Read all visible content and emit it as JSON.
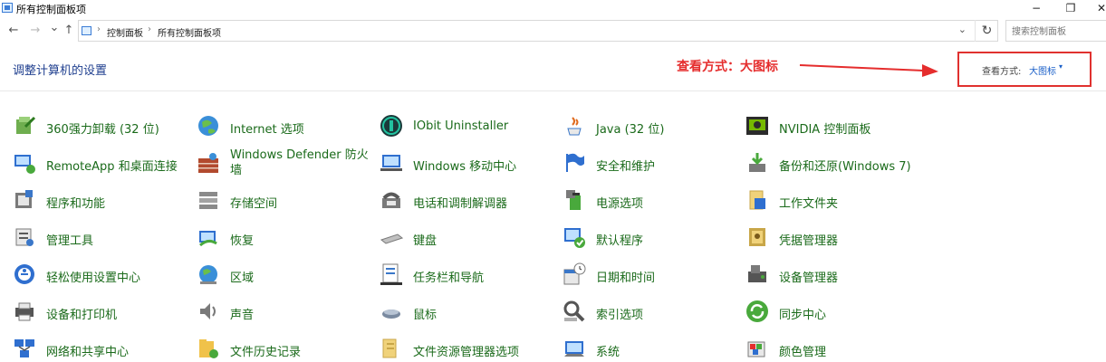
{
  "window": {
    "title": "所有控制面板项",
    "minimize": "−",
    "maximize": "❐",
    "close": "✕"
  },
  "nav": {
    "back": "←",
    "forward": "→",
    "recent": "⌄",
    "up": "↑",
    "breadcrumb": [
      "控制面板",
      "所有控制面板项"
    ],
    "dropdown": "⌄",
    "refresh": "↻",
    "search_placeholder": "搜索控制面板"
  },
  "page": {
    "heading": "调整计算机的设置",
    "annotation": "查看方式：大图标",
    "view_label": "查看方式:",
    "view_value": "大图标",
    "view_caret": "▾"
  },
  "colors": {
    "link_green": "#1a6a1a",
    "heading_blue": "#1f3f8f",
    "annotation_red": "#e52d2d",
    "view_link_blue": "#1a5fc8"
  },
  "items": [
    [
      {
        "label": "360强力卸载 (32 位)",
        "icon": "uninstall-icon"
      },
      {
        "label": "RemoteApp 和桌面连接",
        "icon": "remote-desktop-icon"
      },
      {
        "label": "程序和功能",
        "icon": "programs-icon"
      },
      {
        "label": "管理工具",
        "icon": "admin-tools-icon"
      },
      {
        "label": "轻松使用设置中心",
        "icon": "ease-of-access-icon"
      },
      {
        "label": "设备和打印机",
        "icon": "printer-icon"
      },
      {
        "label": "网络和共享中心",
        "icon": "network-icon"
      }
    ],
    [
      {
        "label": "Internet 选项",
        "icon": "globe-icon"
      },
      {
        "label": "Windows Defender 防火墙",
        "icon": "firewall-icon"
      },
      {
        "label": "存储空间",
        "icon": "storage-icon"
      },
      {
        "label": "恢复",
        "icon": "recovery-icon"
      },
      {
        "label": "区域",
        "icon": "region-globe-icon"
      },
      {
        "label": "声音",
        "icon": "speaker-icon"
      },
      {
        "label": "文件历史记录",
        "icon": "file-history-icon"
      }
    ],
    [
      {
        "label": "IObit Uninstaller",
        "icon": "iobit-icon"
      },
      {
        "label": "Windows 移动中心",
        "icon": "mobility-center-icon"
      },
      {
        "label": "电话和调制解调器",
        "icon": "phone-modem-icon"
      },
      {
        "label": "键盘",
        "icon": "keyboard-icon"
      },
      {
        "label": "任务栏和导航",
        "icon": "taskbar-icon"
      },
      {
        "label": "鼠标",
        "icon": "mouse-icon"
      },
      {
        "label": "文件资源管理器选项",
        "icon": "folder-options-icon"
      }
    ],
    [
      {
        "label": "Java (32 位)",
        "icon": "java-icon"
      },
      {
        "label": "安全和维护",
        "icon": "security-flag-icon"
      },
      {
        "label": "电源选项",
        "icon": "power-icon"
      },
      {
        "label": "默认程序",
        "icon": "default-programs-icon"
      },
      {
        "label": "日期和时间",
        "icon": "calendar-clock-icon"
      },
      {
        "label": "索引选项",
        "icon": "indexing-icon"
      },
      {
        "label": "系统",
        "icon": "system-icon"
      }
    ],
    [
      {
        "label": "NVIDIA 控制面板",
        "icon": "nvidia-icon"
      },
      {
        "label": "备份和还原(Windows 7)",
        "icon": "backup-icon"
      },
      {
        "label": "工作文件夹",
        "icon": "work-folders-icon"
      },
      {
        "label": "凭据管理器",
        "icon": "credential-icon"
      },
      {
        "label": "设备管理器",
        "icon": "device-manager-icon"
      },
      {
        "label": "同步中心",
        "icon": "sync-icon"
      },
      {
        "label": "颜色管理",
        "icon": "color-management-icon"
      }
    ]
  ]
}
